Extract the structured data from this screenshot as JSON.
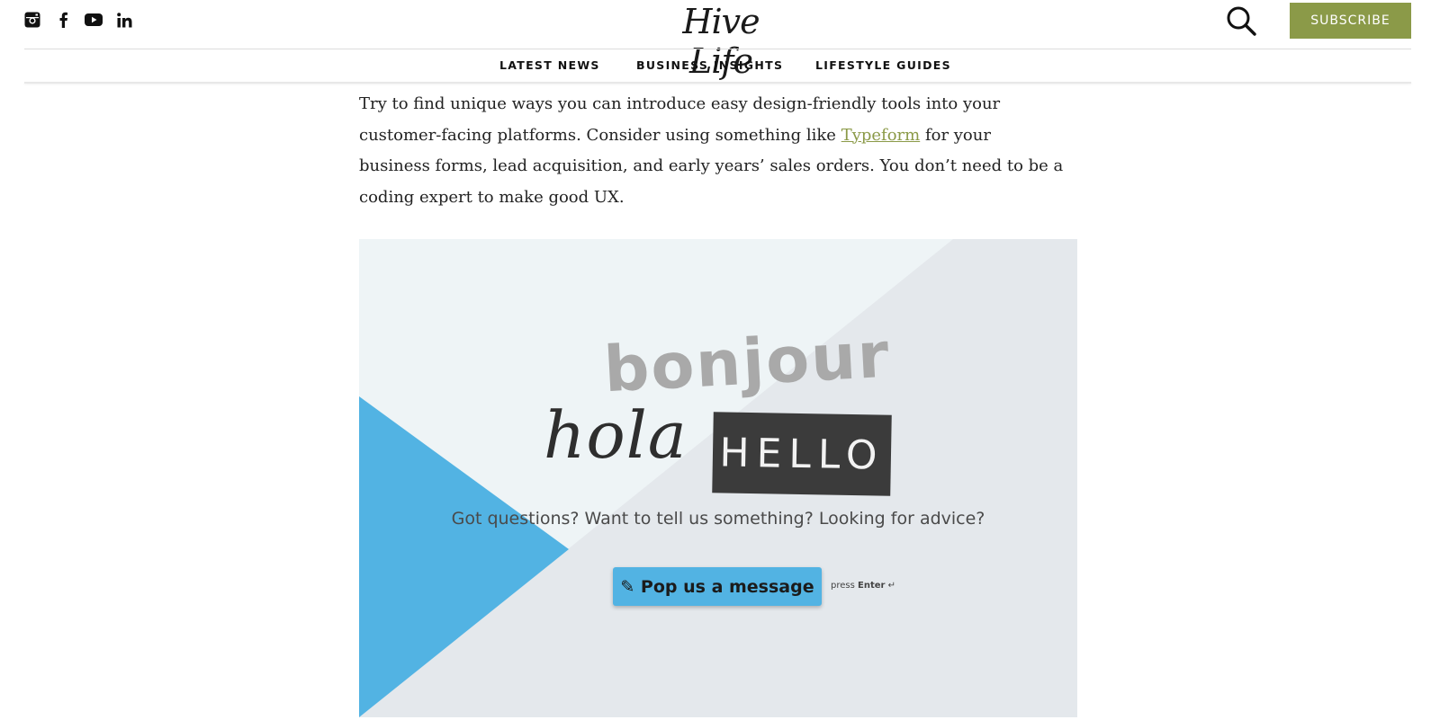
{
  "header": {
    "social_icons": [
      "instagram-icon",
      "facebook-icon",
      "youtube-icon",
      "linkedin-icon"
    ],
    "logo_text": "Hive Life",
    "search_icon": "search-icon",
    "subscribe_label": "SUBSCRIBE"
  },
  "nav": {
    "items": [
      "LATEST NEWS",
      "BUSINESS INSIGHTS",
      "LIFESTYLE GUIDES"
    ]
  },
  "article": {
    "text_before_link": "Try to find unique ways you can introduce easy design-friendly tools into your customer-facing platforms. Consider using something like ",
    "link_text": "Typeform",
    "text_after_link": " for your business forms, lead acquisition, and early years’ sales orders. You don’t need to be a coding expert to make good UX."
  },
  "embed": {
    "word_bonjour": "bonjour",
    "word_hola": "hola",
    "word_hello": "HELLO",
    "question": "Got questions? Want to tell us something? Looking for advice?",
    "button_icon": "✎",
    "button_label": "Pop us a message",
    "press_prefix": "press",
    "press_key": "Enter",
    "press_icon": "↵"
  },
  "colors": {
    "accent_green": "#8b9a48",
    "embed_blue": "#52b3e3",
    "embed_light": "#eef4f6",
    "embed_grey": "#e4e8ec"
  }
}
